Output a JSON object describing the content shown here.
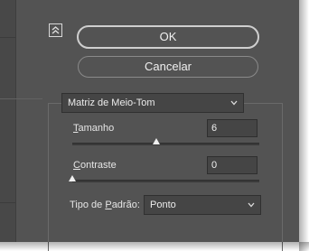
{
  "buttons": {
    "ok": "OK",
    "cancel": "Cancelar"
  },
  "collapse_icon": "collapse-up-icon",
  "matrix_dropdown": {
    "value": "Matriz de Meio-Tom"
  },
  "size": {
    "label_first": "T",
    "label_rest": "amanho",
    "value": "6",
    "slider_fraction": 0.45
  },
  "contrast": {
    "label_first": "C",
    "label_rest": "ontraste",
    "value": "0",
    "slider_fraction": 0.0
  },
  "pattern_type": {
    "label_prefix": "Tipo de ",
    "label_underlined": "P",
    "label_suffix": "adrão:",
    "value": "Ponto"
  },
  "colors": {
    "panel": "#535353",
    "field": "#454545",
    "text": "#e8e8e8"
  }
}
